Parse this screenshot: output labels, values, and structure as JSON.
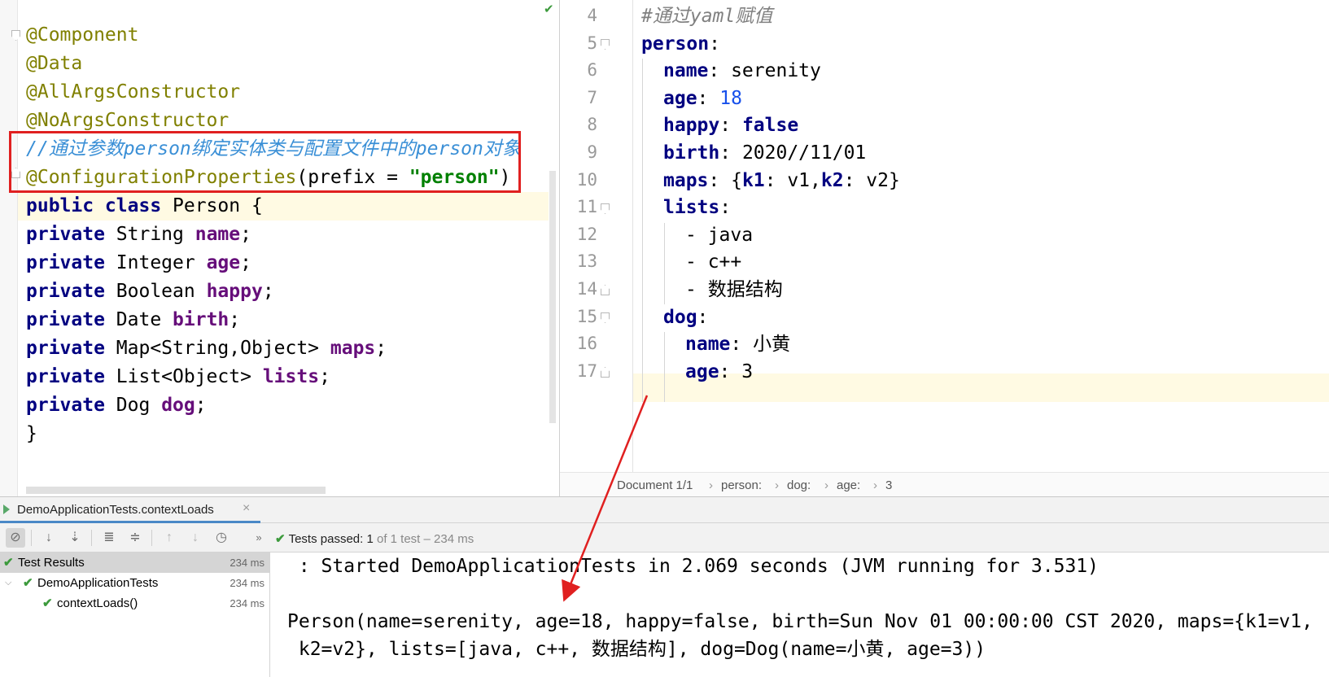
{
  "left_editor": {
    "lines": [
      {
        "parts": [
          {
            "t": "@Component",
            "c": "ann"
          }
        ]
      },
      {
        "parts": [
          {
            "t": "@Data",
            "c": "ann"
          }
        ]
      },
      {
        "parts": [
          {
            "t": "@AllArgsConstructor",
            "c": "ann"
          }
        ]
      },
      {
        "parts": [
          {
            "t": "@NoArgsConstructor",
            "c": "ann"
          }
        ]
      },
      {
        "parts": [
          {
            "t": "//通过参数person绑定实体类与配置文件中的person对象",
            "c": "cmt"
          }
        ]
      },
      {
        "parts": [
          {
            "t": "@ConfigurationProperties",
            "c": "ann"
          },
          {
            "t": "(prefix = ",
            "c": ""
          },
          {
            "t": "\"person\"",
            "c": "str"
          },
          {
            "t": ")",
            "c": ""
          }
        ]
      },
      {
        "parts": [
          {
            "t": "public class",
            "c": "kw"
          },
          {
            "t": " Person {",
            "c": ""
          }
        ]
      },
      {
        "parts": [
          {
            "t": "private",
            "c": "kw"
          },
          {
            "t": " String ",
            "c": ""
          },
          {
            "t": "name",
            "c": "fld"
          },
          {
            "t": ";",
            "c": ""
          }
        ]
      },
      {
        "parts": [
          {
            "t": "private",
            "c": "kw"
          },
          {
            "t": " Integer ",
            "c": ""
          },
          {
            "t": "age",
            "c": "fld"
          },
          {
            "t": ";",
            "c": ""
          }
        ]
      },
      {
        "parts": [
          {
            "t": "private",
            "c": "kw"
          },
          {
            "t": " Boolean ",
            "c": ""
          },
          {
            "t": "happy",
            "c": "fld"
          },
          {
            "t": ";",
            "c": ""
          }
        ]
      },
      {
        "parts": [
          {
            "t": "private",
            "c": "kw"
          },
          {
            "t": " Date ",
            "c": ""
          },
          {
            "t": "birth",
            "c": "fld"
          },
          {
            "t": ";",
            "c": ""
          }
        ]
      },
      {
        "parts": [
          {
            "t": "private",
            "c": "kw"
          },
          {
            "t": " Map<String,Object> ",
            "c": ""
          },
          {
            "t": "maps",
            "c": "fld"
          },
          {
            "t": ";",
            "c": ""
          }
        ]
      },
      {
        "parts": [
          {
            "t": "private",
            "c": "kw"
          },
          {
            "t": " List<Object> ",
            "c": ""
          },
          {
            "t": "lists",
            "c": "fld"
          },
          {
            "t": ";",
            "c": ""
          }
        ]
      },
      {
        "parts": [
          {
            "t": "private",
            "c": "kw"
          },
          {
            "t": " Dog ",
            "c": ""
          },
          {
            "t": "dog",
            "c": "fld"
          },
          {
            "t": ";",
            "c": ""
          }
        ]
      },
      {
        "parts": [
          {
            "t": "}",
            "c": ""
          }
        ]
      }
    ]
  },
  "right_editor": {
    "lines": [
      {
        "n": "4",
        "indent": 0,
        "parts": [
          {
            "t": "#通过yaml赋值",
            "c": "ycmt"
          }
        ]
      },
      {
        "n": "5",
        "indent": 0,
        "parts": [
          {
            "t": "person",
            "c": "ykey"
          },
          {
            "t": ":",
            "c": ""
          }
        ]
      },
      {
        "n": "6",
        "indent": 1,
        "parts": [
          {
            "t": "name",
            "c": "ykey"
          },
          {
            "t": ": serenity",
            "c": ""
          }
        ]
      },
      {
        "n": "7",
        "indent": 1,
        "parts": [
          {
            "t": "age",
            "c": "ykey"
          },
          {
            "t": ": ",
            "c": ""
          },
          {
            "t": "18",
            "c": "ynum"
          }
        ]
      },
      {
        "n": "8",
        "indent": 1,
        "parts": [
          {
            "t": "happy",
            "c": "ykey"
          },
          {
            "t": ": ",
            "c": ""
          },
          {
            "t": "false",
            "c": "ykey"
          }
        ]
      },
      {
        "n": "9",
        "indent": 1,
        "parts": [
          {
            "t": "birth",
            "c": "ykey"
          },
          {
            "t": ": 2020//11/01",
            "c": ""
          }
        ]
      },
      {
        "n": "10",
        "indent": 1,
        "parts": [
          {
            "t": "maps",
            "c": "ykey"
          },
          {
            "t": ": {",
            "c": ""
          },
          {
            "t": "k1",
            "c": "ykey"
          },
          {
            "t": ": v1,",
            "c": ""
          },
          {
            "t": "k2",
            "c": "ykey"
          },
          {
            "t": ": v2}",
            "c": ""
          }
        ]
      },
      {
        "n": "11",
        "indent": 1,
        "parts": [
          {
            "t": "lists",
            "c": "ykey"
          },
          {
            "t": ":",
            "c": ""
          }
        ]
      },
      {
        "n": "12",
        "indent": 2,
        "parts": [
          {
            "t": "- java",
            "c": ""
          }
        ]
      },
      {
        "n": "13",
        "indent": 2,
        "parts": [
          {
            "t": "- c++",
            "c": ""
          }
        ]
      },
      {
        "n": "14",
        "indent": 2,
        "parts": [
          {
            "t": "- 数据结构",
            "c": ""
          }
        ]
      },
      {
        "n": "15",
        "indent": 1,
        "parts": [
          {
            "t": "dog",
            "c": "ykey"
          },
          {
            "t": ":",
            "c": ""
          }
        ]
      },
      {
        "n": "16",
        "indent": 2,
        "parts": [
          {
            "t": "name",
            "c": "ykey"
          },
          {
            "t": ": 小黄",
            "c": ""
          }
        ]
      },
      {
        "n": "17",
        "indent": 2,
        "parts": [
          {
            "t": "age",
            "c": "ykey"
          },
          {
            "t": ": 3",
            "c": ""
          }
        ]
      }
    ],
    "breadcrumb": [
      "Document 1/1",
      "person:",
      "dog:",
      "age:",
      "3"
    ],
    "breadcrumb_sep": "›"
  },
  "run_panel": {
    "tab_label": "DemoApplicationTests.contextLoads",
    "close_glyph": "×",
    "status": {
      "prefix": "Tests passed:",
      "count": "1",
      "suffix": "of 1 test – 234 ms"
    },
    "tree": [
      {
        "label": "Test Results",
        "time": "234 ms",
        "level": 0
      },
      {
        "label": "DemoApplicationTests",
        "time": "234 ms",
        "level": 1
      },
      {
        "label": "contextLoads()",
        "time": "234 ms",
        "level": 2
      }
    ],
    "console": [
      " : Started DemoApplicationTests in 2.069 seconds (JVM running for 3.531)",
      "",
      "Person(name=serenity, age=18, happy=false, birth=Sun Nov 01 00:00:00 CST 2020, maps={k1=v1,",
      " k2=v2}, lists=[java, c++, 数据结构], dog=Dog(name=小黄, age=3))"
    ]
  },
  "colors": {
    "annotation_box": "#e02020",
    "arrow": "#e02020",
    "pass": "#3c9a3c"
  }
}
